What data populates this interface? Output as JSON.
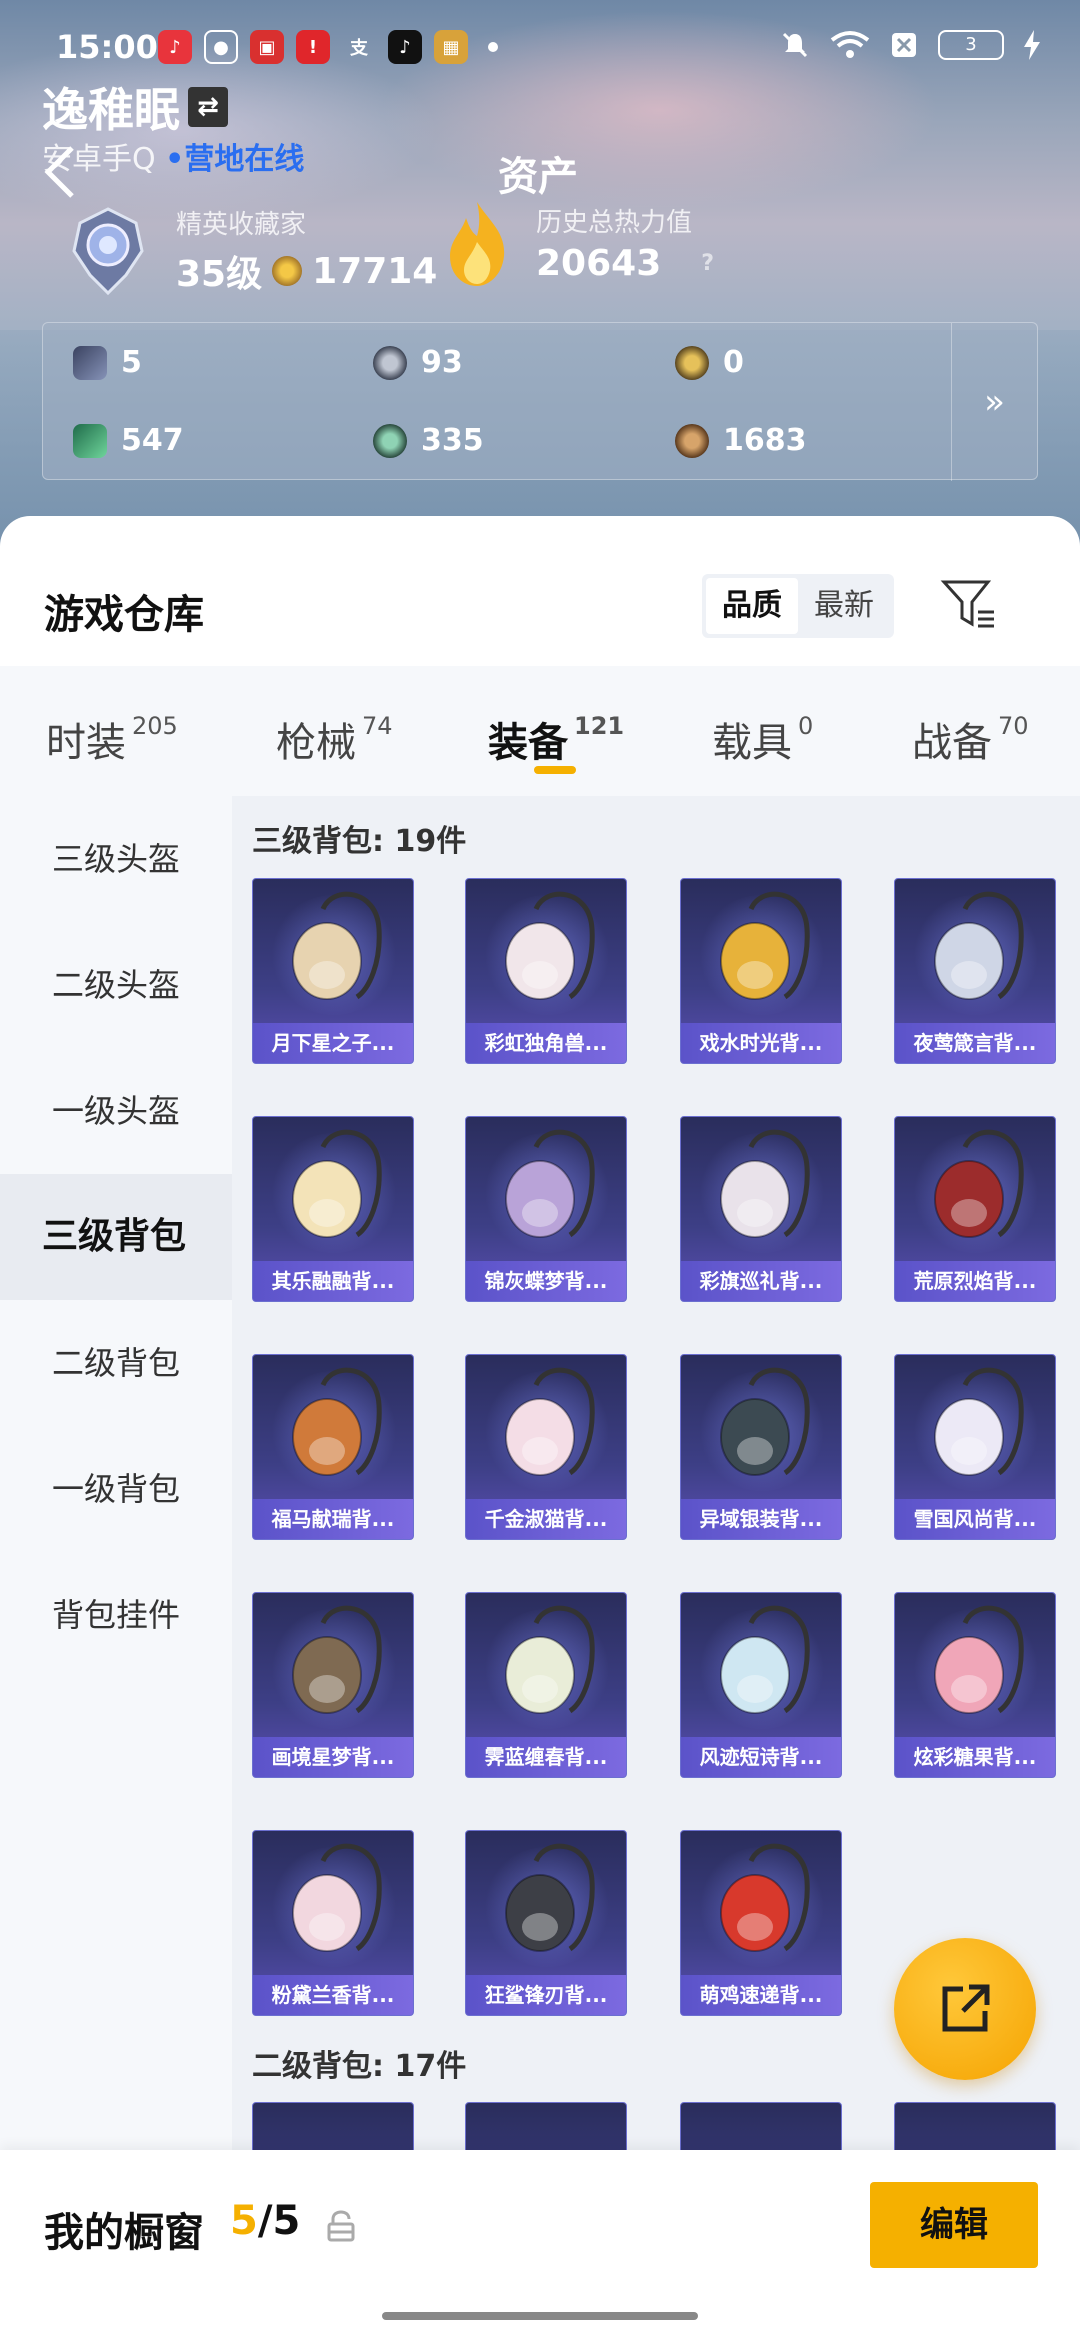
{
  "status_bar": {
    "time": "15:00",
    "battery": "3"
  },
  "profile": {
    "username": "逸稚眠",
    "platform": "安卓手Q",
    "online_status": "营地在线",
    "rank_title": "精英收藏家",
    "level": "35级",
    "coins": "17714",
    "heat_label": "历史总热力值",
    "heat_value": "20643",
    "help": "?"
  },
  "page_title": "资产",
  "resources": [
    "5",
    "93",
    "0",
    "547",
    "335",
    "1683"
  ],
  "warehouse": {
    "title": "游戏仓库",
    "sort_options": [
      "品质",
      "最新"
    ],
    "sort_active": "品质"
  },
  "tabs": [
    {
      "label": "时装",
      "count": "205"
    },
    {
      "label": "枪械",
      "count": "74"
    },
    {
      "label": "装备",
      "count": "121"
    },
    {
      "label": "载具",
      "count": "0"
    },
    {
      "label": "战备",
      "count": "70"
    }
  ],
  "sidebar": [
    "三级头盔",
    "二级头盔",
    "一级头盔",
    "三级背包",
    "二级背包",
    "一级背包",
    "背包挂件"
  ],
  "sidebar_active": "三级背包",
  "sections": [
    {
      "title": "三级背包: 19件",
      "items": [
        "月下星之子...",
        "彩虹独角兽...",
        "戏水时光背...",
        "夜莺箴言背...",
        "其乐融融背...",
        "锦灰蝶梦背...",
        "彩旗巡礼背...",
        "荒原烈焰背...",
        "福马献瑞背...",
        "千金淑猫背...",
        "异域银装背...",
        "雪国风尚背...",
        "画境星梦背...",
        "霁蓝缠春背...",
        "风迹短诗背...",
        "炫彩糖果背...",
        "粉黛兰香背...",
        "狂鲨锋刃背...",
        "萌鸡速递背..."
      ]
    },
    {
      "title": "二级背包: 17件",
      "items": []
    }
  ],
  "showcase": {
    "label": "我的橱窗",
    "used": "5",
    "total": "/5",
    "edit_label": "编辑"
  },
  "colors": {
    "accent": "#f5b000",
    "card_bg": "#3d3f86",
    "online": "#2a6ef0"
  }
}
